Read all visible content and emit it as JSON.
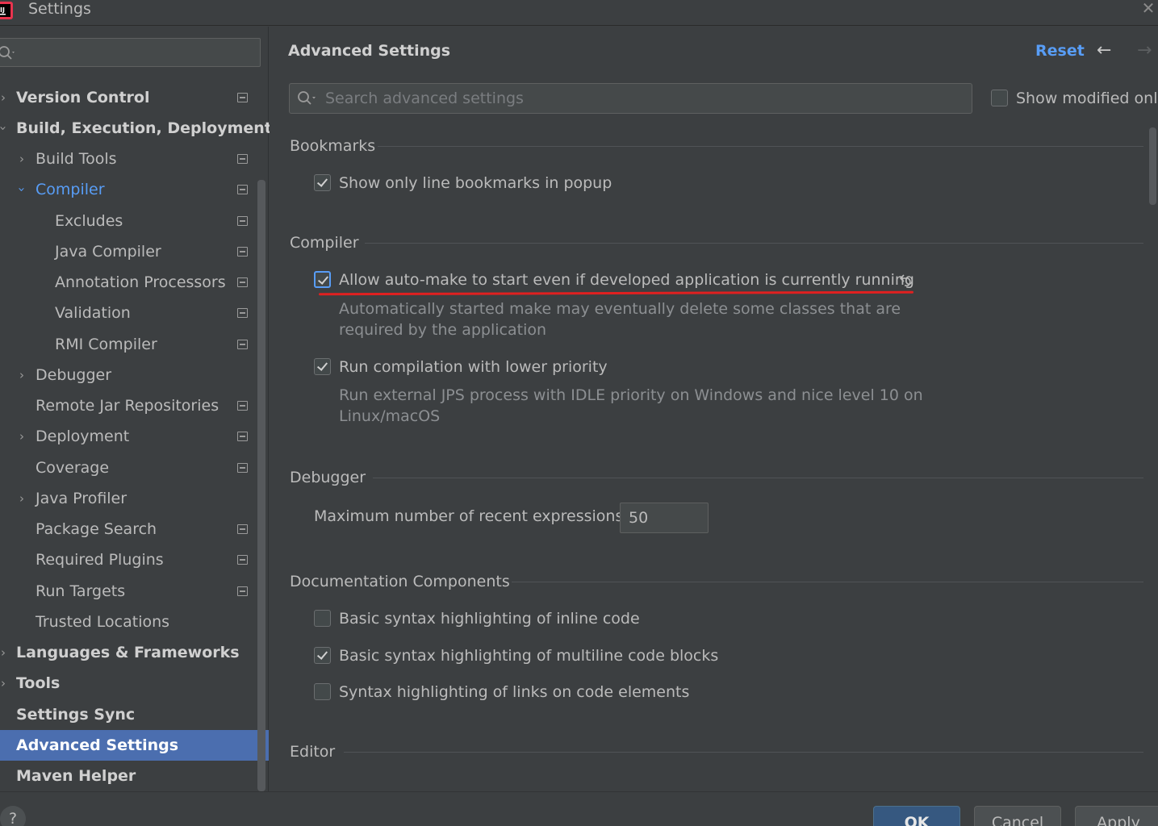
{
  "window": {
    "title": "Settings"
  },
  "sidebar": {
    "search_placeholder": "",
    "items": [
      {
        "label": "Version Control"
      },
      {
        "label": "Build, Execution, Deployment"
      },
      {
        "label": "Build Tools"
      },
      {
        "label": "Compiler"
      },
      {
        "label": "Excludes"
      },
      {
        "label": "Java Compiler"
      },
      {
        "label": "Annotation Processors"
      },
      {
        "label": "Validation"
      },
      {
        "label": "RMI Compiler"
      },
      {
        "label": "Debugger"
      },
      {
        "label": "Remote Jar Repositories"
      },
      {
        "label": "Deployment"
      },
      {
        "label": "Coverage"
      },
      {
        "label": "Java Profiler"
      },
      {
        "label": "Package Search"
      },
      {
        "label": "Required Plugins"
      },
      {
        "label": "Run Targets"
      },
      {
        "label": "Trusted Locations"
      },
      {
        "label": "Languages & Frameworks"
      },
      {
        "label": "Tools"
      },
      {
        "label": "Settings Sync"
      },
      {
        "label": "Advanced Settings"
      },
      {
        "label": "Maven Helper"
      }
    ]
  },
  "main": {
    "title": "Advanced Settings",
    "reset_label": "Reset",
    "search_placeholder": "Search advanced settings",
    "show_modified_label": "Show modified only",
    "sections": {
      "bookmarks": {
        "title": "Bookmarks",
        "show_line_bookmarks": "Show only line bookmarks in popup"
      },
      "compiler": {
        "title": "Compiler",
        "auto_make_label": "Allow auto-make to start even if developed application is currently running",
        "auto_make_desc": "Automatically started make may eventually delete some classes that are required by the application",
        "low_priority_label": "Run compilation with lower priority",
        "low_priority_desc": "Run external JPS process with IDLE priority on Windows and nice level 10 on Linux/macOS"
      },
      "debugger": {
        "title": "Debugger",
        "recent_expressions_label": "Maximum number of recent expressions:",
        "recent_expressions_value": "50"
      },
      "documentation": {
        "title": "Documentation Components",
        "inline_code": "Basic syntax highlighting of inline code",
        "multiline_code": "Basic syntax highlighting of multiline code blocks",
        "links_code": "Syntax highlighting of links on code elements"
      },
      "editor": {
        "title": "Editor"
      }
    }
  },
  "footer": {
    "help_label": "?",
    "ok_label": "OK",
    "cancel_label": "Cancel",
    "apply_label": "Apply"
  },
  "colors": {
    "background": "#3c3f41",
    "accent": "#589df6",
    "selection": "#4b6eaf",
    "highlight_underline": "#e02020"
  }
}
